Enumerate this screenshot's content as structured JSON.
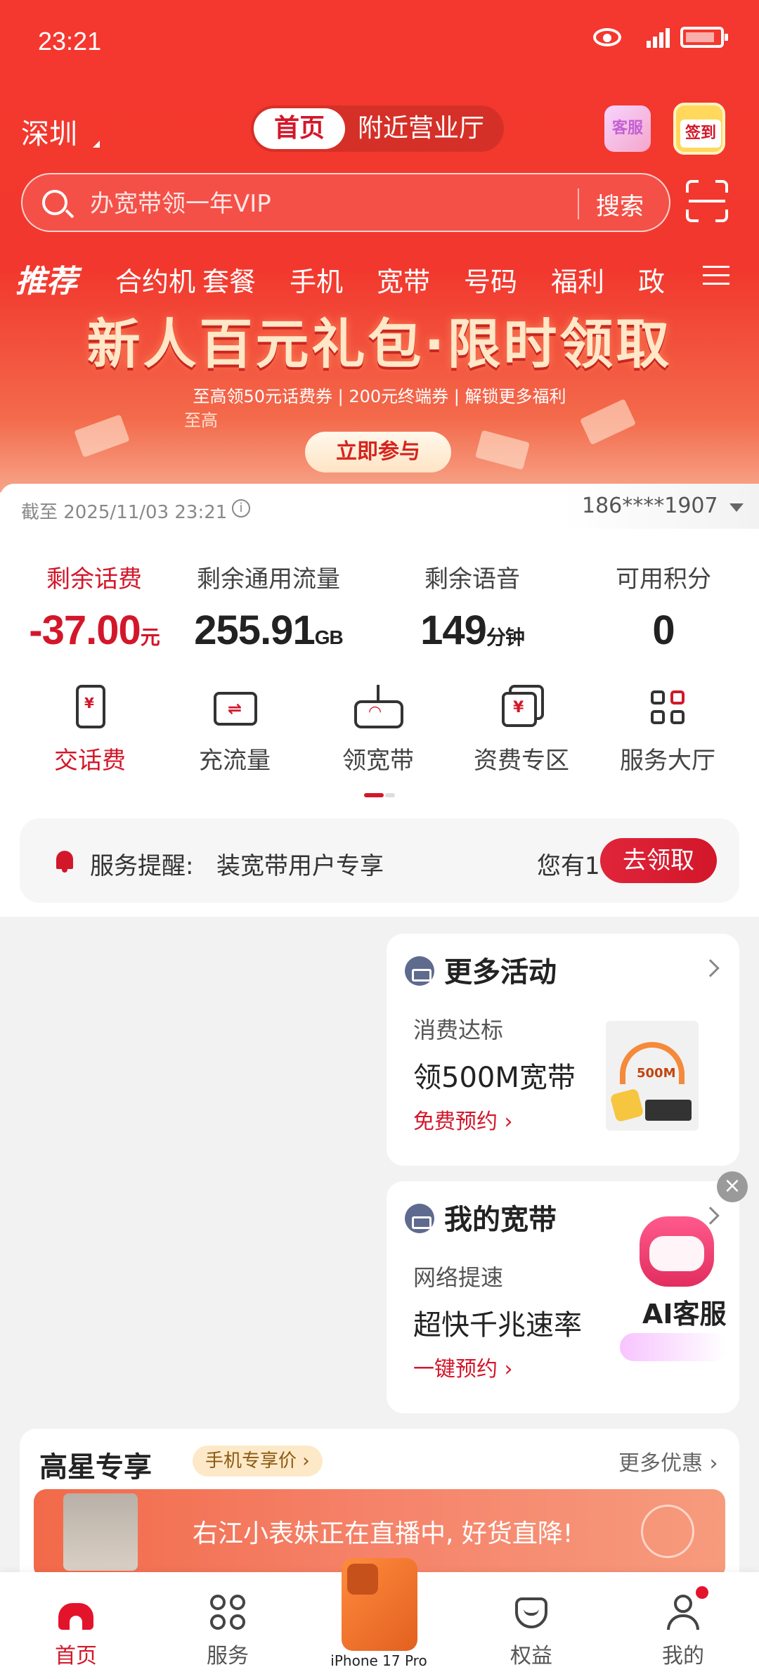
{
  "status_bar": {
    "time": "23:21"
  },
  "header": {
    "city": "深圳",
    "tabs": [
      {
        "label": "首页",
        "active": true
      },
      {
        "label": "附近营业厅",
        "active": false
      }
    ],
    "service_label": "客服",
    "checkin_label": "签到"
  },
  "search": {
    "placeholder": "办宽带领一年VIP",
    "button": "搜索"
  },
  "categories": {
    "featured": "推荐",
    "items": [
      "合约机",
      "套餐",
      "手机",
      "宽带",
      "号码",
      "福利",
      "政"
    ]
  },
  "banner": {
    "title": "新人百元礼包·限时领取",
    "subtitle": "至高领50元话费券 | 200元终端券 | 解锁更多福利",
    "subtitle2": "至高",
    "cta": "立即参与"
  },
  "account": {
    "as_of": "截至 2025/11/03 23:21",
    "phone": "186****1907",
    "stats": [
      {
        "label": "剩余话费",
        "value": "-37.00",
        "unit": "元"
      },
      {
        "label": "剩余通用流量",
        "value": "255.91",
        "unit": "GB"
      },
      {
        "label": "剩余语音",
        "value": "149",
        "unit": "分钟"
      },
      {
        "label": "可用积分",
        "value": "0",
        "unit": ""
      }
    ],
    "actions": [
      "交话费",
      "充流量",
      "领宽带",
      "资费专区",
      "服务大厅"
    ]
  },
  "notice": {
    "label": "服务提醒:",
    "text": "装宽带用户专享",
    "count_prefix": "您有1",
    "button": "去领取"
  },
  "cards": [
    {
      "title": "更多活动",
      "sub": "消费达标",
      "main": "领500M宽带",
      "link": "免费预约 ›",
      "img_text": "500M"
    },
    {
      "title": "我的宽带",
      "sub": "网络提速",
      "main": "超快千兆速率",
      "link": "一键预约 ›"
    }
  ],
  "ai_float": {
    "label": "AI客服",
    "close": "×"
  },
  "star": {
    "title": "高星专享",
    "tag": "手机专享价 ›",
    "more": "更多优惠 ›",
    "live_text": "右江小表妹正在直播中, 好货直降!"
  },
  "tabbar": {
    "items": [
      "首页",
      "服务",
      "权益",
      "我的"
    ],
    "center_label": "iPhone 17 Pro"
  },
  "colors": {
    "brand": "#d3172a",
    "hero": "#f4372f"
  }
}
